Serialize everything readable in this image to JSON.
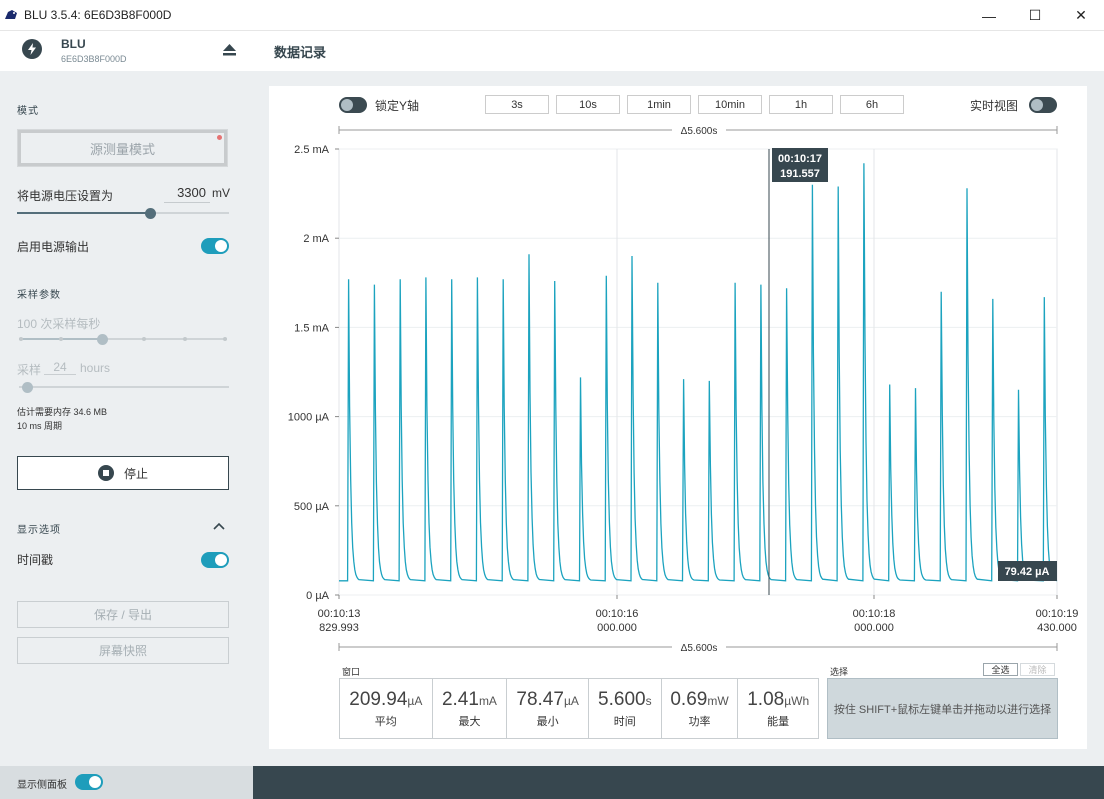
{
  "window": {
    "title": "BLU 3.5.4: 6E6D3B8F000D",
    "minimize": "—",
    "maximize": "☐",
    "close": "✕"
  },
  "device": {
    "name": "BLU",
    "serial": "6E6D3B8F000D"
  },
  "sidebar": {
    "mode_label": "模式",
    "mode_button": "源测量模式",
    "voltage_label": "将电源电压设置为",
    "voltage_value": "3300",
    "voltage_unit": "mV",
    "voltage_level": 0.63,
    "power_output_label": "启用电源输出",
    "power_output_on": true,
    "sampling_label": "采样参数",
    "sample_rate_text": "100 次采样每秒",
    "sample_rate_step": 2,
    "sample_label": "采样",
    "sample_value": "24",
    "sample_unit": "hours",
    "memory_text": "估计需要内存 34.6 MB",
    "period_text": "10 ms 周期",
    "stop_button": "停止",
    "display_options_label": "显示选项",
    "timestamp_label": "时间戳",
    "timestamp_on": true,
    "save_button": "保存 / 导出",
    "screenshot_button": "屏幕快照",
    "show_sidebar_label": "显示侧面板",
    "show_sidebar_on": true
  },
  "main": {
    "title": "数据记录",
    "lock_y_label": "锁定Y轴",
    "lock_y_on": false,
    "time_windows": [
      "3s",
      "10s",
      "1min",
      "10min",
      "1h",
      "6h"
    ],
    "realtime_label": "实时视图",
    "realtime_on": false,
    "delta_top": "Δ5.600s",
    "delta_bottom": "Δ5.600s"
  },
  "chart_data": {
    "type": "line",
    "ylabels": [
      "2.5 mA",
      "2 mA",
      "1.5 mA",
      "1000 µA",
      "500 µA",
      "0 µA"
    ],
    "ylim_uA": [
      0,
      2500
    ],
    "baseline_uA": 79.42,
    "xlabels": [
      {
        "line1": "00:10:13",
        "line2": "829.993"
      },
      {
        "line1": "00:10:16",
        "line2": "000.000"
      },
      {
        "line1": "00:10:18",
        "line2": "000.000"
      },
      {
        "line1": "00:10:19",
        "line2": "430.000"
      }
    ],
    "spike_times_s": [
      0.1,
      0.4,
      0.7,
      1.0,
      1.3,
      1.6,
      1.9,
      2.2,
      2.5,
      2.8,
      3.1,
      3.4,
      3.7,
      4.0,
      4.3,
      4.6,
      4.9,
      5.2,
      5.5,
      5.8,
      6.1,
      6.4,
      6.7,
      7.0,
      7.3,
      7.6,
      7.9,
      8.2
    ],
    "spike_peaks_uA": [
      1770,
      1740,
      1770,
      1780,
      1770,
      1780,
      1770,
      1910,
      1760,
      1220,
      1790,
      1900,
      1750,
      1210,
      1200,
      1750,
      1740,
      1720,
      2300,
      2290,
      2420,
      1180,
      1160,
      1700,
      2280,
      1660,
      1150,
      1670
    ],
    "x_range_s": [
      0,
      8.36
    ],
    "cursor": {
      "time": "00:10:17",
      "value": "191.557"
    },
    "end_value": "79.42 µA"
  },
  "stats": {
    "window_label": "窗口",
    "items": [
      {
        "value": "209.94",
        "unit": "µA",
        "label": "平均"
      },
      {
        "value": "2.41",
        "unit": "mA",
        "label": "最大"
      },
      {
        "value": "78.47",
        "unit": "µA",
        "label": "最小"
      },
      {
        "value": "5.600",
        "unit": "s",
        "label": "时间"
      },
      {
        "value": "0.69",
        "unit": "mW",
        "label": "功率"
      },
      {
        "value": "1.08",
        "unit": "µWh",
        "label": "能量"
      }
    ],
    "selection_label": "选择",
    "select_all": "全选",
    "clear": "清除",
    "selection_hint": "按住 SHIFT+鼠标左键单击并拖动以进行选择"
  }
}
